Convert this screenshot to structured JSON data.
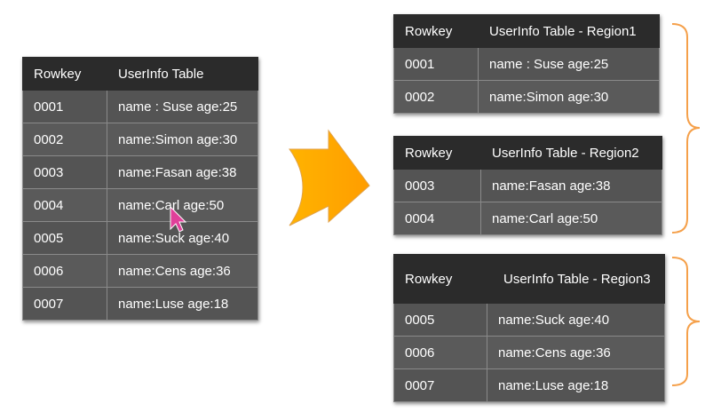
{
  "colors": {
    "header_bg": "#2b2b2b",
    "cell_bg": "#5a5a5a",
    "arrow_fill": "#ffa500",
    "brace_color": "#f5a04a",
    "cursor_fill": "#e0409a"
  },
  "main_table": {
    "headers": [
      "Rowkey",
      "UserInfo Table"
    ],
    "rows": [
      [
        "0001",
        "name : Suse age:25"
      ],
      [
        "0002",
        "name:Simon age:30"
      ],
      [
        "0003",
        "name:Fasan age:38"
      ],
      [
        "0004",
        "name:Carl age:50"
      ],
      [
        "0005",
        "name:Suck age:40"
      ],
      [
        "0006",
        "name:Cens age:36"
      ],
      [
        "0007",
        "name:Luse age:18"
      ]
    ]
  },
  "regions": [
    {
      "headers": [
        "Rowkey",
        "UserInfo Table - Region1"
      ],
      "rows": [
        [
          "0001",
          "name : Suse age:25"
        ],
        [
          "0002",
          "name:Simon age:30"
        ]
      ]
    },
    {
      "headers": [
        "Rowkey",
        "UserInfo Table - Region2"
      ],
      "rows": [
        [
          "0003",
          "name:Fasan age:38"
        ],
        [
          "0004",
          "name:Carl age:50"
        ]
      ]
    },
    {
      "headers": [
        "Rowkey",
        "UserInfo Table - Region3"
      ],
      "rows": [
        [
          "0005",
          "name:Suck age:40"
        ],
        [
          "0006",
          "name:Cens age:36"
        ],
        [
          "0007",
          "name:Luse age:18"
        ]
      ]
    }
  ],
  "icons": {
    "arrow": "right-arrow-icon",
    "cursor": "mouse-cursor-icon",
    "brace": "right-curly-brace-icon"
  }
}
